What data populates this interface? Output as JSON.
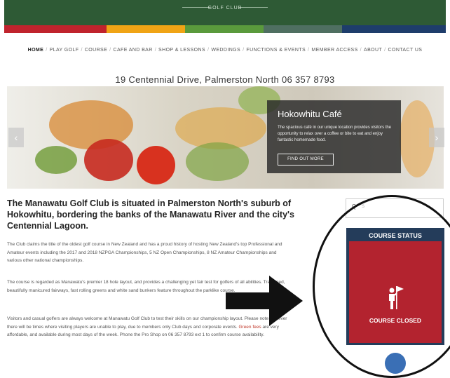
{
  "header": {
    "club_text": "GOLF CLUB",
    "color_bars": [
      "#c0232d",
      "#f0a415",
      "#5a9a3c",
      "#4f6f61",
      "#1e3d6b"
    ]
  },
  "nav": {
    "items": [
      "HOME",
      "PLAY GOLF",
      "COURSE",
      "CAFE AND BAR",
      "SHOP & LESSONS",
      "WEDDINGS",
      "FUNCTIONS & EVENTS",
      "MEMBER ACCESS",
      "ABOUT",
      "CONTACT US"
    ],
    "separator": "/",
    "active_index": 0
  },
  "address": "19 Centennial Drive, Palmerston North 06 357 8793",
  "hero": {
    "prev_icon": "chevron-left-icon",
    "next_icon": "chevron-right-icon",
    "prev_glyph": "‹",
    "next_glyph": "›",
    "cafe_title": "Hokowhitu Café",
    "cafe_description": "The spacious café in our unique location provides visitors the opportunity to relax over a coffee or bite to eat and enjoy fantastic homemade food.",
    "cafe_button": "FIND OUT MORE"
  },
  "main": {
    "heading": "The Manawatu Golf Club is situated in Palmerston North's suburb of Hokowhitu, bordering the banks of the Manawatu River and the city's Centennial Lagoon.",
    "paragraph1": "The Club claims the title of the oldest golf course in New Zealand and has a proud history of hosting New Zealand's top Professional and Amateur events including the 2017 and 2018 NZPGA Championships, 5 NZ Open Championships, 8 NZ Amateur Championships and various other national championships.",
    "paragraph2": "The course is regarded as Manawatu's premier 18 hole layout, and provides a challenging yet fair test for golfers of all abilities. Tree-lined, beautifully manicured fairways, fast rolling greens and white sand bunkers feature throughout the parklike course.",
    "paragraph3_before": "Visitors and casual golfers are always welcome at Manawatu Golf Club to test their skills on our championship layout. Please note however there will be times where visiting players are unable to play, due to members only Club days and corporate events. ",
    "paragraph3_link": "Green fees",
    "paragraph3_after": " are very affordable, and available during most days of the week. Phone the Pro Shop on 06 357 8793 ext 1 to confirm course availability."
  },
  "sidebar": {
    "search_icon": "search-icon",
    "search_glyph": "Q",
    "search_placeholder": "S",
    "status_title": "COURSE STATUS",
    "status_icon": "golfer-flag-icon",
    "status_text": "COURSE CLOSED",
    "status_color": "#b3232f",
    "panel_color": "#243c5a"
  }
}
